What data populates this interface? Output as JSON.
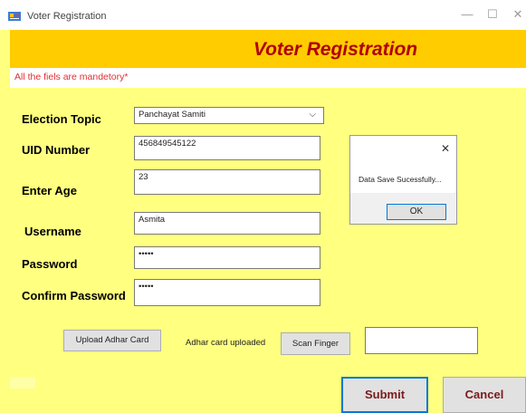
{
  "window": {
    "title": "Voter Registration",
    "minimize_glyph": "—",
    "maximize_glyph": "☐",
    "close_glyph": "✕"
  },
  "header": {
    "title": "Voter Registration"
  },
  "info": {
    "text": "All the fiels are mandetory*"
  },
  "form": {
    "election_topic_label": "Election Topic",
    "election_topic_value": "Panchayat Samiti",
    "uid_label": "UID Number",
    "uid_value": "456849545122",
    "age_label": "Enter Age",
    "age_value": "23",
    "username_label": "Username",
    "username_value": "Asmita",
    "password_label": "Password",
    "password_value": "•••••",
    "confirm_label": "Confirm Password",
    "confirm_value": "•••••"
  },
  "actions": {
    "upload_label": "Upload Adhar Card",
    "upload_status": "Adhar card uploaded",
    "scan_label": "Scan Finger",
    "submit_label": "Submit",
    "cancel_label": "Cancel"
  },
  "dialog": {
    "message": "Data Save Sucessfully...",
    "ok_label": "OK",
    "close_glyph": "✕"
  },
  "colors": {
    "background": "#ffff80",
    "header_band": "#ffcc00",
    "header_text": "#b00000",
    "info_text": "#e03030"
  }
}
